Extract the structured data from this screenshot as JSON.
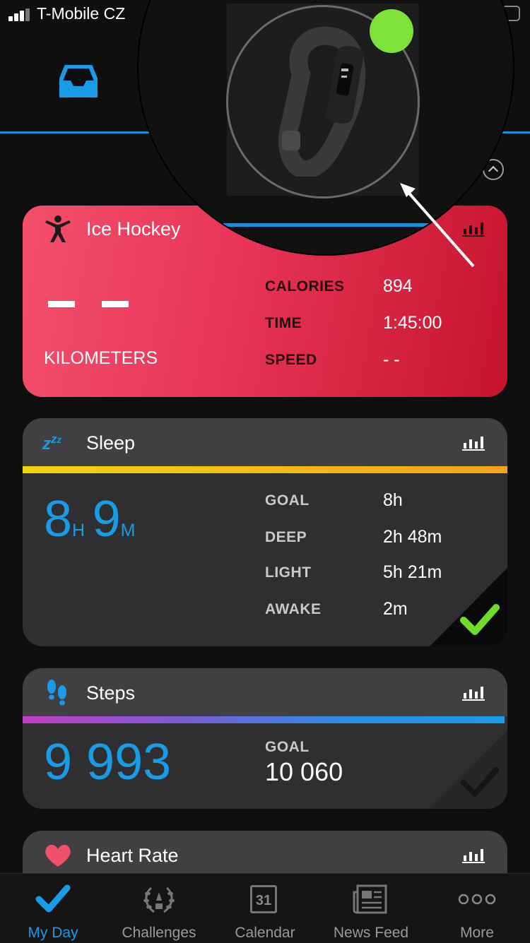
{
  "status_bar": {
    "carrier": "T-Mobile CZ"
  },
  "activity_card": {
    "title": "Ice Hockey",
    "main_value": "— —",
    "main_unit": "KILOMETERS",
    "stats": [
      {
        "label": "CALORIES",
        "value": "894"
      },
      {
        "label": "TIME",
        "value": "1:45:00"
      },
      {
        "label": "SPEED",
        "value": "- -"
      }
    ]
  },
  "sleep_card": {
    "title": "Sleep",
    "hours": "8",
    "hours_unit": "H",
    "minutes": "9",
    "minutes_unit": "M",
    "stats": [
      {
        "label": "GOAL",
        "value": "8h"
      },
      {
        "label": "DEEP",
        "value": "2h 48m"
      },
      {
        "label": "LIGHT",
        "value": "5h 21m"
      },
      {
        "label": "AWAKE",
        "value": "2m"
      }
    ],
    "goal_met": true
  },
  "steps_card": {
    "title": "Steps",
    "value": "9 993",
    "goal_label": "GOAL",
    "goal_value": "10 060",
    "goal_met": false
  },
  "heart_card": {
    "title": "Heart Rate"
  },
  "tabs": [
    {
      "label": "My Day",
      "icon": "checkmark-icon",
      "active": true
    },
    {
      "label": "Challenges",
      "icon": "laurel-icon",
      "active": false
    },
    {
      "label": "Calendar",
      "icon": "calendar-icon",
      "active": false,
      "badge": "31"
    },
    {
      "label": "News Feed",
      "icon": "newspaper-icon",
      "active": false
    },
    {
      "label": "More",
      "icon": "more-icon",
      "active": false
    }
  ],
  "colors": {
    "accent": "#1a9be6",
    "activity_red": "#e73457",
    "check_green": "#6fdc2a",
    "device_dot": "#7fe23a"
  }
}
